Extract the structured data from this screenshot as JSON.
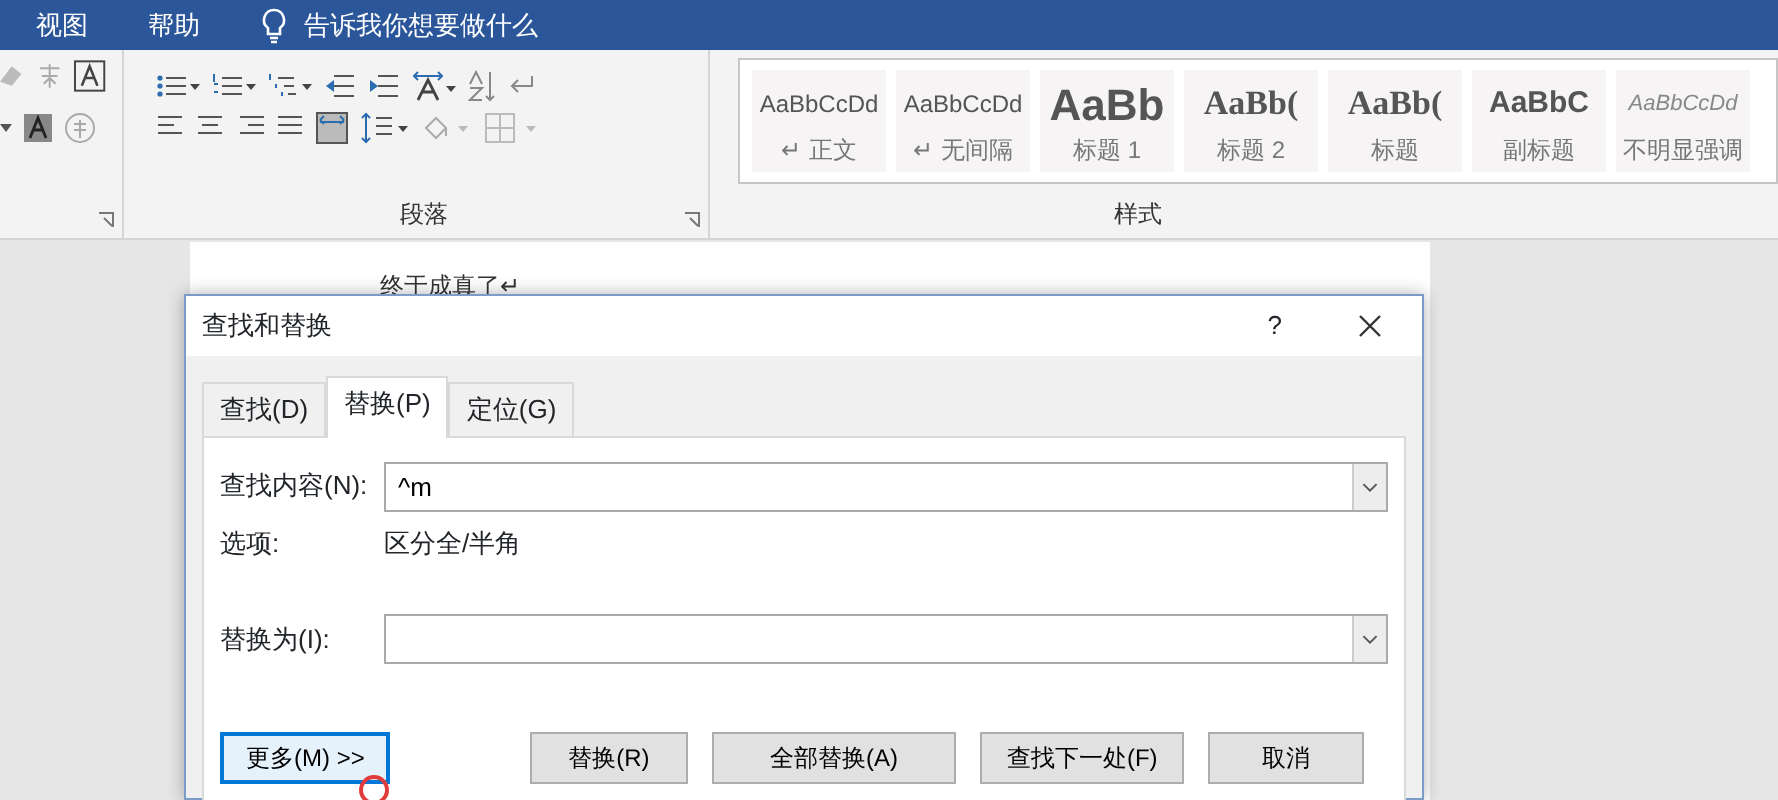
{
  "menu": [
    {
      "label": "视图"
    },
    {
      "label": "帮助"
    }
  ],
  "tell_me": {
    "placeholder": "告诉我你想要做什么"
  },
  "ribbon": {
    "paragraph_group": {
      "label": "段落"
    },
    "styles_group": {
      "label": "样式"
    },
    "styles": [
      {
        "preview": "AaBbCcDd",
        "label": "正文",
        "mark": "↵",
        "kind": "body"
      },
      {
        "preview": "AaBbCcDd",
        "label": "无间隔",
        "mark": "↵",
        "kind": "body"
      },
      {
        "preview": "AaBb",
        "label": "标题 1",
        "kind": "heading1"
      },
      {
        "preview": "AaBb(",
        "label": "标题 2",
        "kind": "heading2"
      },
      {
        "preview": "AaBb(",
        "label": "标题",
        "kind": "title"
      },
      {
        "preview": "AaBbC",
        "label": "副标题",
        "kind": "subtitle"
      },
      {
        "preview": "AaBbCcDd",
        "label": "不明显强调",
        "kind": "subtle"
      }
    ]
  },
  "document": {
    "text": "终于成真了↵"
  },
  "dialog": {
    "title": "查找和替换",
    "help": "?",
    "tabs": [
      {
        "label": "查找(D)",
        "selected": false
      },
      {
        "label": "替换(P)",
        "selected": true
      },
      {
        "label": "定位(G)",
        "selected": false
      }
    ],
    "find": {
      "label": "查找内容(N):",
      "value": "^m"
    },
    "options": {
      "label": "选项:",
      "value": "区分全/半角"
    },
    "replace": {
      "label": "替换为(I):"
    },
    "buttons": [
      {
        "label": "更多(M) >>",
        "selected": true
      },
      {
        "label": "替换(R)",
        "selected": false
      },
      {
        "label": "全部替换(A)",
        "selected": false
      },
      {
        "label": "查找下一处(F)",
        "selected": false
      },
      {
        "label": "取消",
        "selected": false
      }
    ]
  }
}
